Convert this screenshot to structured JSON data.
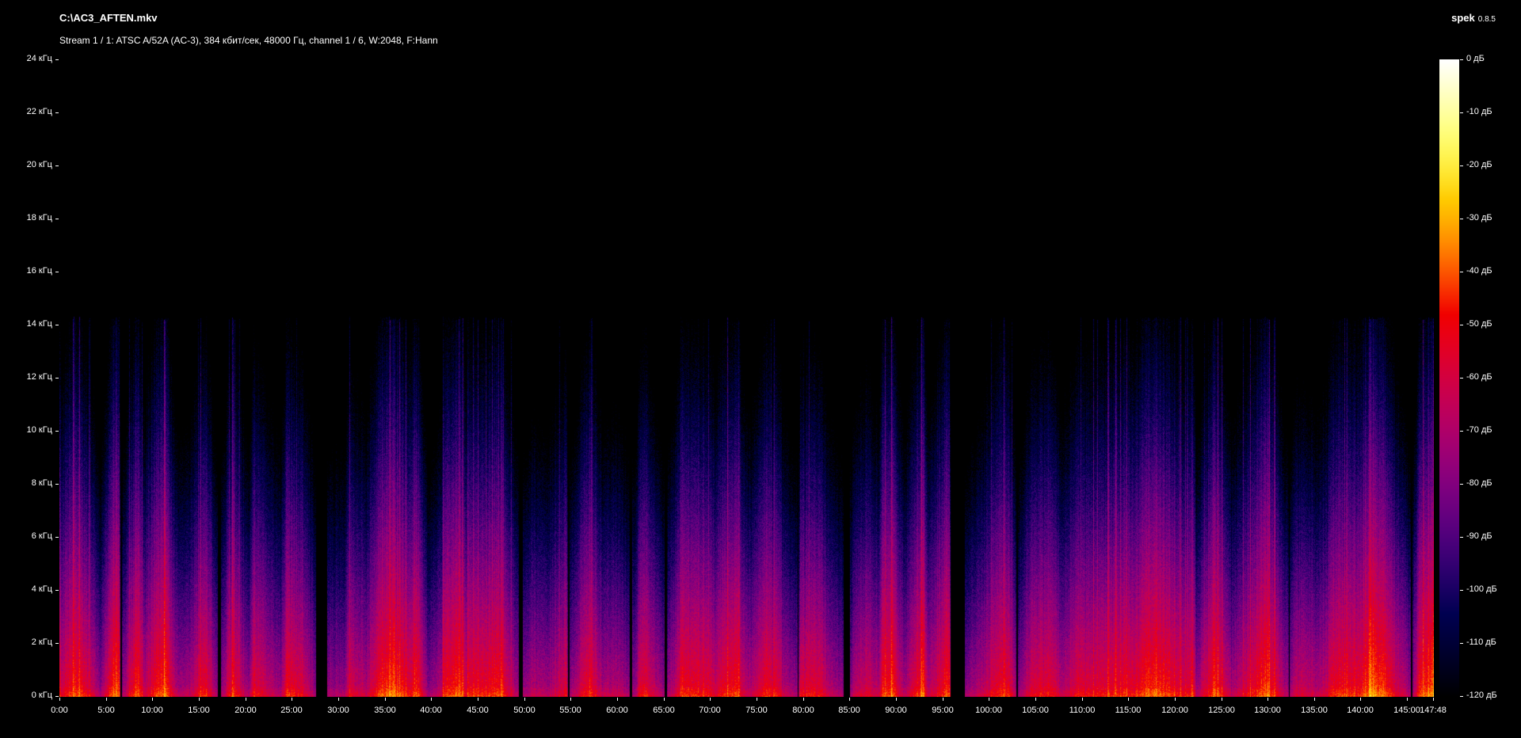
{
  "window": {
    "title": "C:\\AC3_AFTEN.mkv",
    "app_name": "spek",
    "app_version": "0.8.5",
    "stream_info": "Stream 1 / 1: ATSC A/52A (AC-3), 384 кбит/сек, 48000 Гц, channel 1 / 6, W:2048, F:Hann"
  },
  "chart_data": {
    "type": "heatmap",
    "subtype": "audio-spectrogram",
    "title": "C:\\AC3_AFTEN.mkv",
    "subtitle": "Stream 1 / 1: ATSC A/52A (AC-3), 384 кбит/сек, 48000 Гц, channel 1 / 6, W:2048, F:Hann",
    "x_axis": {
      "unit": "min:sec",
      "range_seconds": [
        0,
        8868
      ],
      "duration_label": "147:48",
      "tick_labels": [
        "0:00",
        "5:00",
        "10:00",
        "15:00",
        "20:00",
        "25:00",
        "30:00",
        "35:00",
        "40:00",
        "45:00",
        "50:00",
        "55:00",
        "60:00",
        "65:00",
        "70:00",
        "75:00",
        "80:00",
        "85:00",
        "90:00",
        "95:00",
        "100:00",
        "105:00",
        "110:00",
        "115:00",
        "120:00",
        "125:00",
        "130:00",
        "135:00",
        "140:00",
        "145:00",
        "147:48"
      ]
    },
    "y_axis": {
      "unit": "кГц",
      "range_hz": [
        0,
        24000
      ],
      "tick_labels": [
        "24 кГц",
        "22 кГц",
        "20 кГц",
        "18 кГц",
        "16 кГц",
        "14 кГц",
        "12 кГц",
        "10 кГц",
        "8 кГц",
        "6 кГц",
        "4 кГц",
        "2 кГц",
        "0 кГц"
      ]
    },
    "colorbar": {
      "unit": "дБ",
      "range_db": [
        -120,
        0
      ],
      "tick_labels": [
        "0 дБ",
        "-10 дБ",
        "-20 дБ",
        "-30 дБ",
        "-40 дБ",
        "-50 дБ",
        "-60 дБ",
        "-70 дБ",
        "-80 дБ",
        "-90 дБ",
        "-100 дБ",
        "-110 дБ",
        "-120 дБ"
      ]
    },
    "audio_bandwidth_hz": 14250,
    "palette": "sox-spectrum (black → dark blue → purple → magenta → red → orange → yellow → white)",
    "content_summary": "AC-3 track low-passed near 14.2 kHz: everything above ~14 kHz is black. Below the cutoff, dense vertical stripes of program audio alternate with short black silences; energy is strongest (red/orange, about -30 dB) below 500 Hz, magenta/purple (-45 to -75 dB) through 2-8 kHz, fading to dark blue (-90 to -110 dB) near the cutoff. Occasional loud transients form thin bright columns reaching the full 14 kHz bandwidth."
  }
}
